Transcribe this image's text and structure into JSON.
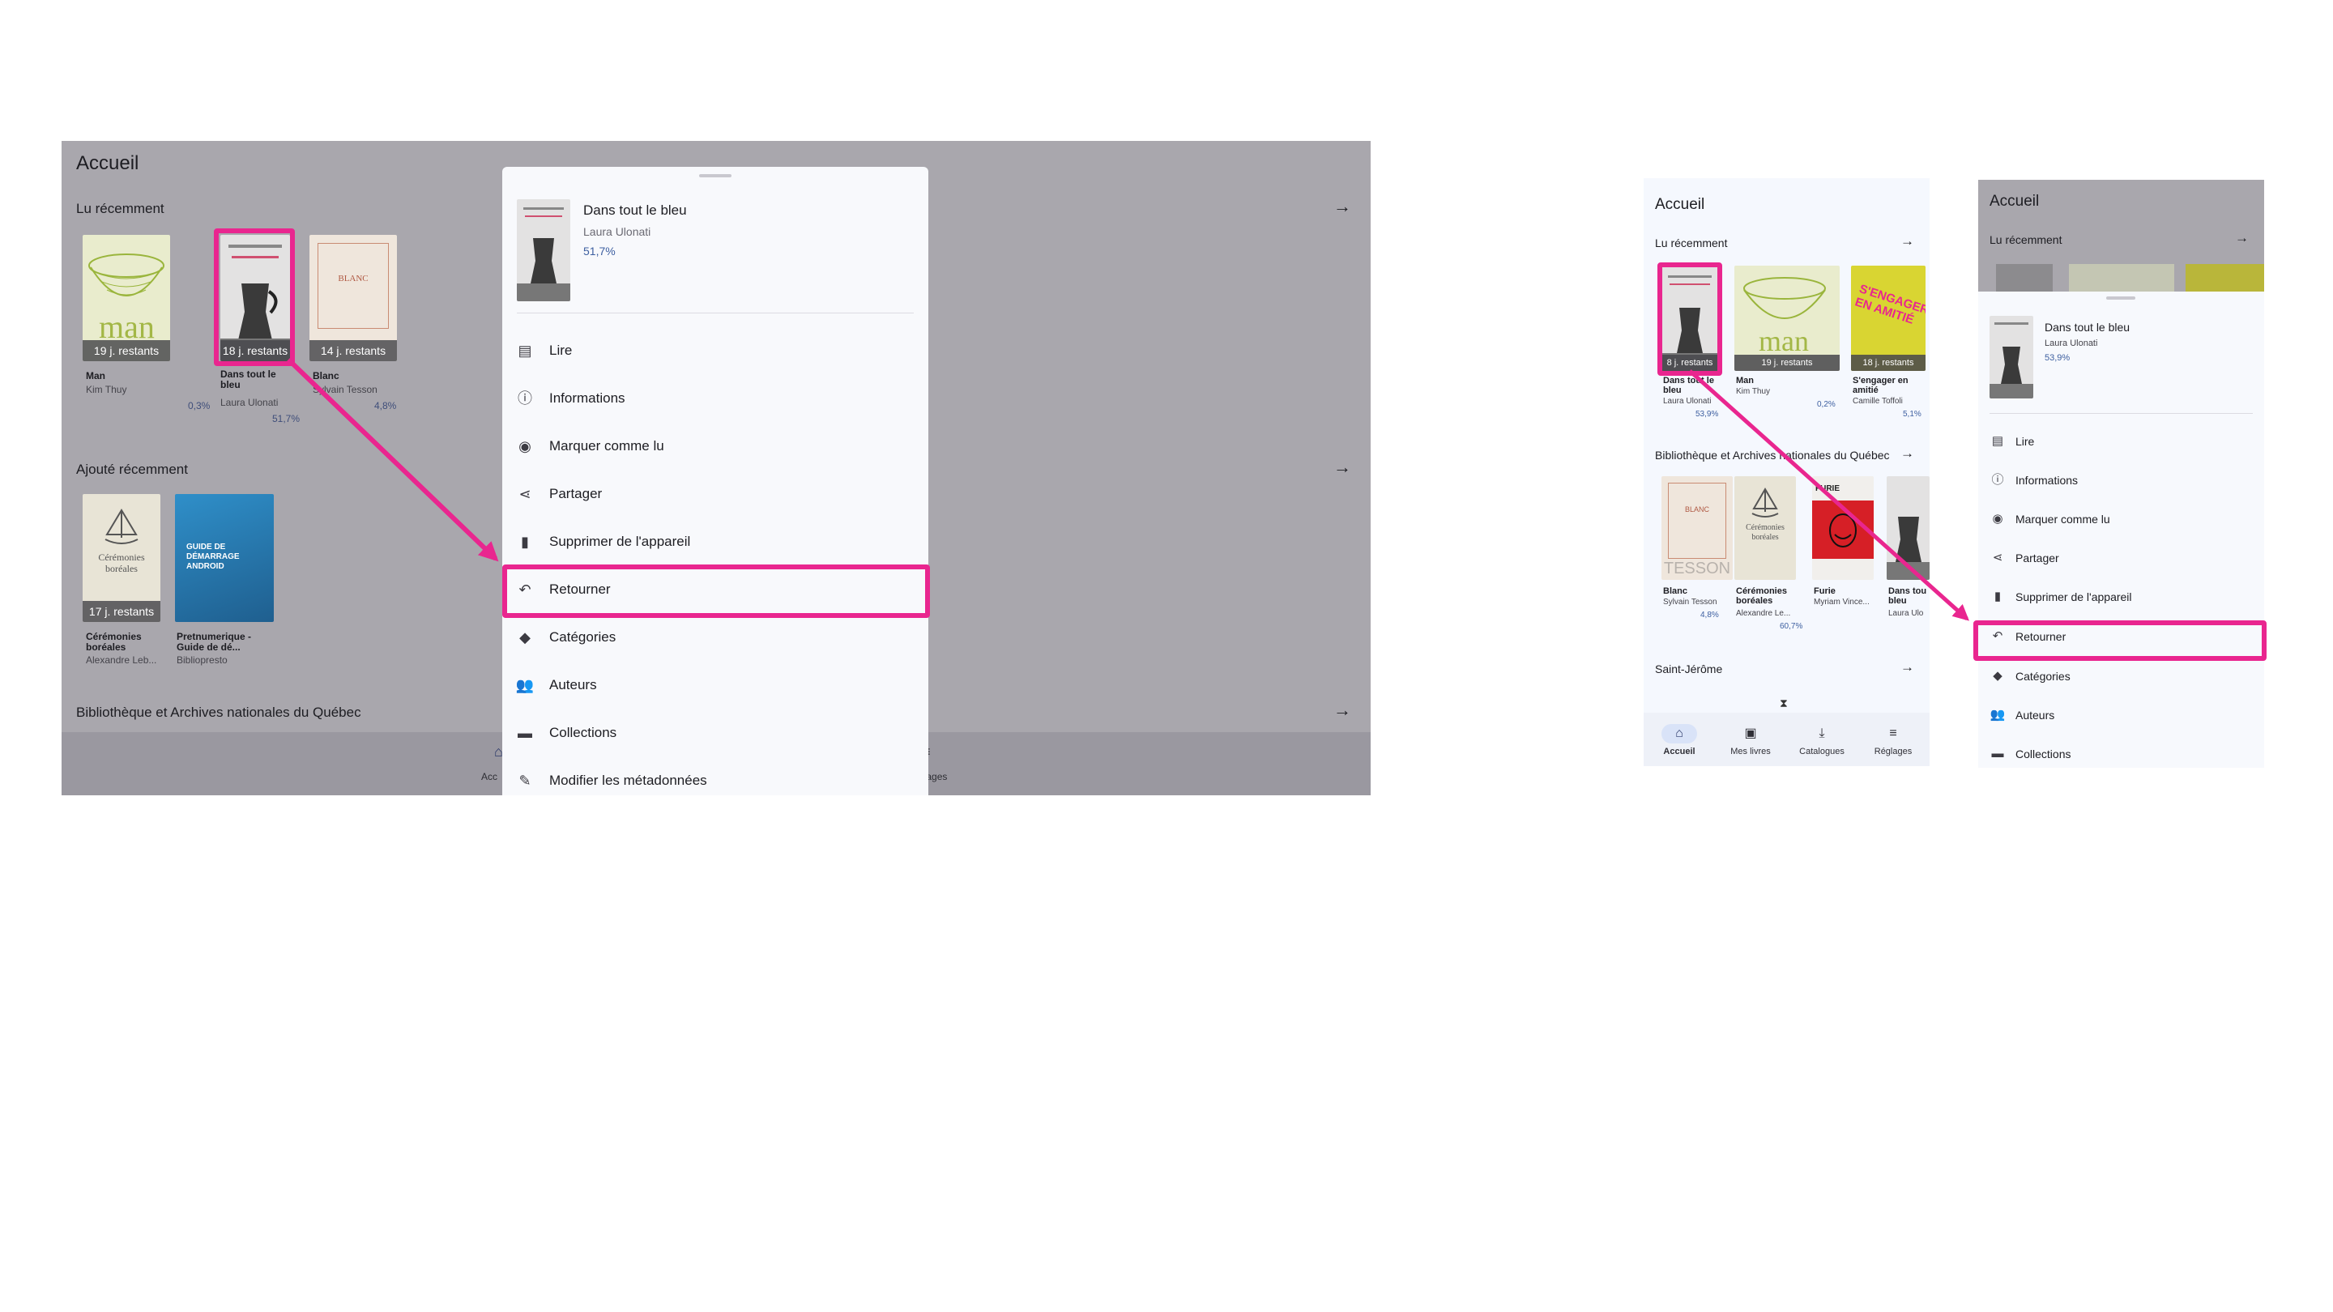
{
  "tablet": {
    "title": "Accueil",
    "recent_label": "Lu récemment",
    "added_label": "Ajouté récemment",
    "library_label": "Bibliothèque et Archives nationales du Québec",
    "recent_books": [
      {
        "title": "Man",
        "author": "Kim Thuy",
        "progress": "0,3%",
        "badge": "19 j. restants"
      },
      {
        "title": "Dans tout le bleu",
        "author": "Laura Ulonati",
        "progress": "51,7%",
        "badge": "18 j. restants"
      },
      {
        "title": "Blanc",
        "author": "Sylvain Tesson",
        "progress": "4,8%",
        "badge": "14 j. restants"
      }
    ],
    "added_books": [
      {
        "title": "Cérémonies boréales",
        "author": "Alexandre Leb...",
        "badge": "17 j. restants"
      },
      {
        "title": "Pretnumerique - Guide de dé...",
        "author": "Bibliopresto"
      }
    ],
    "nav": {
      "home": "Acc",
      "settings": "glages"
    }
  },
  "sheet": {
    "book_title": "Dans tout le bleu",
    "book_author": "Laura Ulonati",
    "book_progress": "51,7%",
    "items": [
      {
        "label": "Lire"
      },
      {
        "label": "Informations"
      },
      {
        "label": "Marquer comme lu"
      },
      {
        "label": "Partager"
      },
      {
        "label": "Supprimer de l'appareil"
      },
      {
        "label": "Retourner"
      },
      {
        "label": "Catégories"
      },
      {
        "label": "Auteurs"
      },
      {
        "label": "Collections"
      },
      {
        "label": "Modifier les métadonnées"
      }
    ]
  },
  "phone1": {
    "title": "Accueil",
    "recent_label": "Lu récemment",
    "library_label": "Bibliothèque et Archives nationales du Québec",
    "saint_jerome_label": "Saint-Jérôme",
    "recent_books": [
      {
        "title": "Dans tout le bleu",
        "author": "Laura Ulonati",
        "progress": "53,9%",
        "badge": "8 j. restants"
      },
      {
        "title": "Man",
        "author": "Kim Thuy",
        "progress": "0,2%",
        "badge": "19 j. restants"
      },
      {
        "title": "S'engager en amitié",
        "author": "Camille Toffoli",
        "progress": "5,1%",
        "badge": "18 j. restants"
      }
    ],
    "library_books": [
      {
        "title": "Blanc",
        "author": "Sylvain Tesson",
        "progress": "4,8%"
      },
      {
        "title": "Cérémonies boréales",
        "author": "Alexandre Le...",
        "progress": "60,7%"
      },
      {
        "title": "Furie",
        "author": "Myriam Vince..."
      },
      {
        "title": "Dans tou bleu",
        "author": "Laura Ulo"
      }
    ],
    "nav": [
      {
        "label": "Accueil"
      },
      {
        "label": "Mes livres"
      },
      {
        "label": "Catalogues"
      },
      {
        "label": "Réglages"
      }
    ]
  },
  "phone2": {
    "title": "Accueil",
    "recent_label": "Lu récemment",
    "book_title": "Dans tout le bleu",
    "book_author": "Laura Ulonati",
    "book_progress": "53,9%",
    "items": [
      {
        "label": "Lire"
      },
      {
        "label": "Informations"
      },
      {
        "label": "Marquer comme lu"
      },
      {
        "label": "Partager"
      },
      {
        "label": "Supprimer de l'appareil"
      },
      {
        "label": "Retourner"
      },
      {
        "label": "Catégories"
      },
      {
        "label": "Auteurs"
      },
      {
        "label": "Collections"
      }
    ]
  },
  "covers": {
    "man_text": "man",
    "blanc_text": "BLANC",
    "tesson_text": "TESSON",
    "engager_text": "S'ENGAGER EN AMITIÉ",
    "furie_text": "FURIE",
    "guide_text": "GUIDE DE DÉMARRAGE ANDROID"
  },
  "colors": {
    "highlight": "#e9268f",
    "accent": "#3d5fa0",
    "scrim": "#a9a7ad"
  }
}
